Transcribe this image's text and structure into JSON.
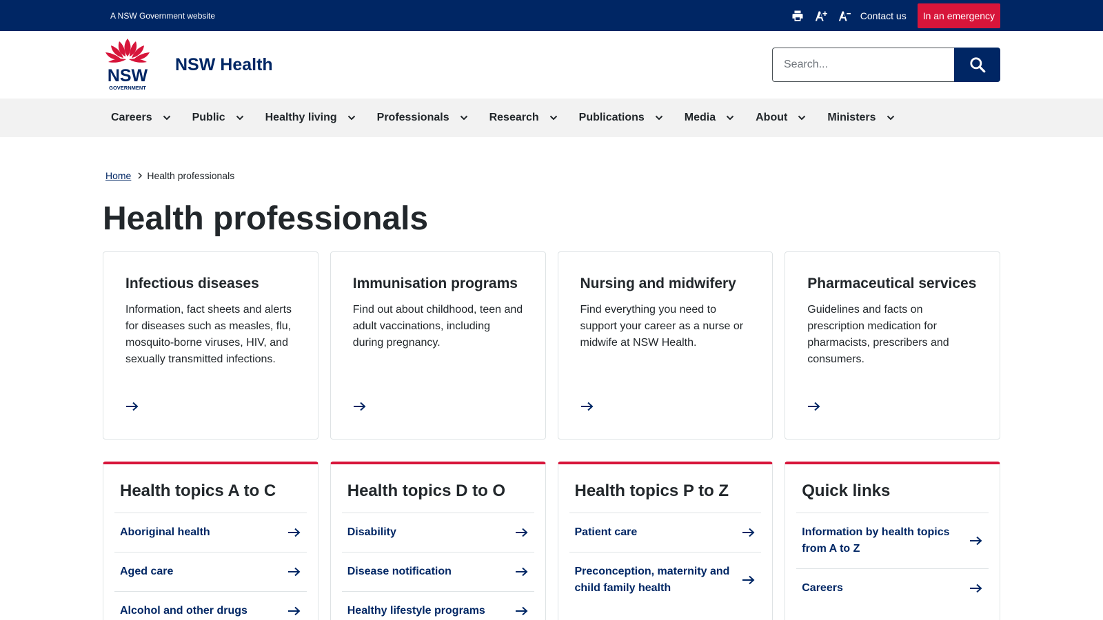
{
  "masthead": {
    "gov_text": "A NSW Government website",
    "contact": "Contact us",
    "emergency": "In an emergency",
    "icons": [
      "print-icon",
      "increase-text-icon",
      "decrease-text-icon"
    ]
  },
  "header": {
    "logo_text": "NSW",
    "logo_subtext": "GOVERNMENT",
    "site_name": "NSW Health",
    "search_placeholder": "Search..."
  },
  "nav": [
    {
      "label": "Careers"
    },
    {
      "label": "Public"
    },
    {
      "label": "Healthy living"
    },
    {
      "label": "Professionals"
    },
    {
      "label": "Research"
    },
    {
      "label": "Publications"
    },
    {
      "label": "Media"
    },
    {
      "label": "About"
    },
    {
      "label": "Ministers"
    }
  ],
  "breadcrumb": {
    "home": "Home",
    "current": "Health professionals"
  },
  "page_title": "Health professionals",
  "cards": [
    {
      "title": "Infectious diseases",
      "desc": "Information, fact sheets and alerts for diseases such as measles, flu, mosquito-borne viruses, HIV, and sexually transmitted infections."
    },
    {
      "title": "Immunisation programs",
      "desc": "Find out about childhood, teen and adult vaccinations, including during pregnancy."
    },
    {
      "title": "Nursing and midwifery",
      "desc": "Find everything you need to support your career as a nurse or midwife at NSW Health."
    },
    {
      "title": "Pharmaceutical services",
      "desc": "Guidelines and facts on prescription medication for pharmacists, prescribers and consumers."
    }
  ],
  "lists": [
    {
      "title": "Health topics A to C",
      "links": [
        "Aboriginal health",
        "Aged care",
        "Alcohol and other drugs"
      ]
    },
    {
      "title": "Health topics D to O",
      "links": [
        "Disability",
        "Disease notification",
        "Healthy lifestyle programs"
      ]
    },
    {
      "title": "Health topics P to Z",
      "links": [
        "Patient care",
        "Preconception, maternity and child family health"
      ]
    },
    {
      "title": "Quick links",
      "links": [
        "Information by health topics from A to Z",
        "Careers"
      ]
    }
  ],
  "colors": {
    "navy": "#002664",
    "red": "#d7153a",
    "nav_bg": "#f2f2f2",
    "text": "#22272b",
    "border": "#dee3e5"
  }
}
